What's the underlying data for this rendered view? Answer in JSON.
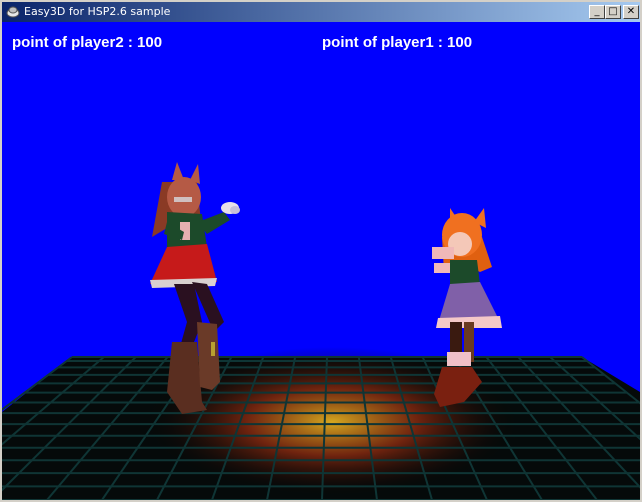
{
  "window": {
    "title": "Easy3D for HSP2.6 sample",
    "buttons": {
      "minimize": "_",
      "maximize": "□",
      "close": "✕"
    }
  },
  "hud": {
    "player2_score": "point of player2 : 100",
    "player1_score": "point of player1 : 100"
  },
  "colors": {
    "background": "#0000fe",
    "floor_grid": "#0d2a2a",
    "floor_glow": "#c8a020"
  },
  "icons": [
    "app-icon",
    "minimize-icon",
    "maximize-icon",
    "close-icon"
  ]
}
